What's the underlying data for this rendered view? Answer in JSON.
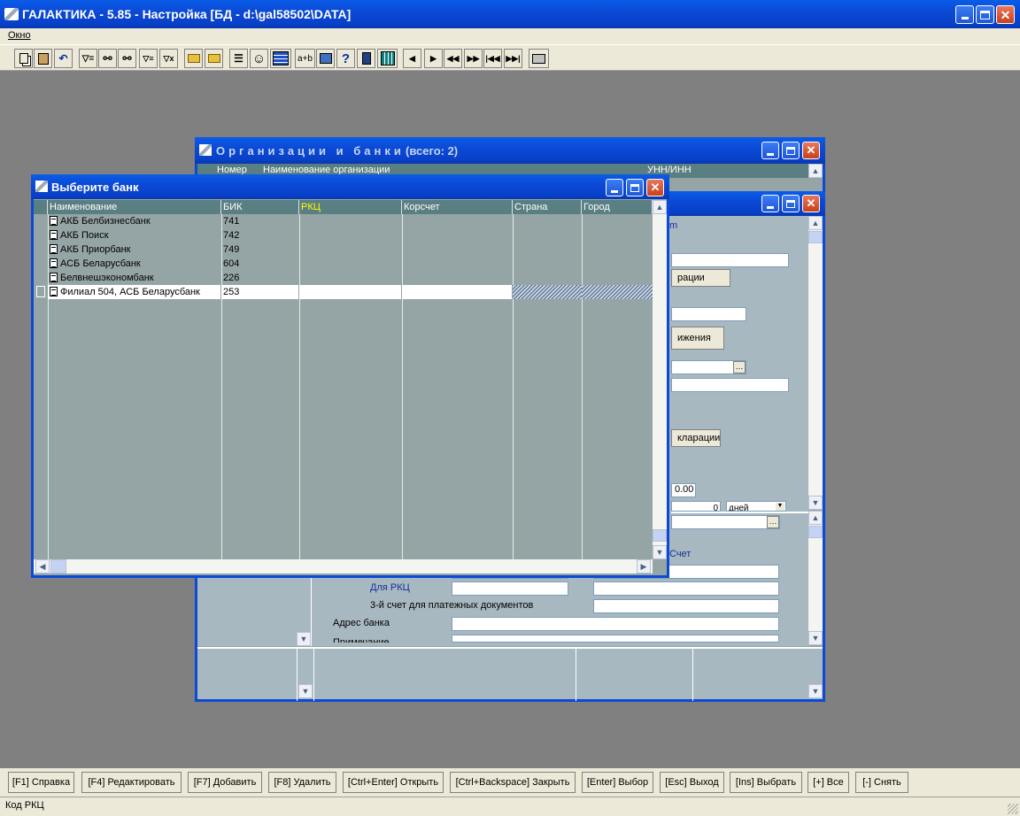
{
  "app": {
    "title": "ГАЛАКТИКА - 5.85 - Настройка [БД - d:\\gal58502\\DATA]",
    "menu": [
      "Окно"
    ]
  },
  "toolbar": {
    "buttons": [
      "copy",
      "paste",
      "undo",
      "filter",
      "find",
      "find-next",
      "filter-set",
      "filter-clear",
      "open",
      "search-folder",
      "list",
      "smile",
      "grid",
      "a+b",
      "calculator",
      "help",
      "exit",
      "table",
      "prev",
      "next",
      "first",
      "last",
      "first-page",
      "last-page",
      "print"
    ],
    "ab_label": "a+b",
    "help_label": "?"
  },
  "org_window": {
    "title": "Организации и банки",
    "count_label": "(всего: 2)",
    "col_number": "Номер",
    "col_name": "Наименование организации",
    "col_unn": "УНН/ИНН",
    "fragments": {
      "m": "m",
      "declaration": "рации",
      "movement": "ижения",
      "declaration2": "кларации",
      "value": "0.00",
      "zero": "0",
      "days": "дней",
      "account": "Счет",
      "for_rkc": "Для РКЦ",
      "third_account": "3-й счет для платежных документов",
      "bank_address": "Адрес банка",
      "note": "Примечание"
    }
  },
  "bank_dialog": {
    "title": "Выберите банк",
    "columns": [
      "Наименование",
      "БИК",
      "РКЦ",
      "Корсчет",
      "Страна",
      "Город"
    ],
    "rows": [
      {
        "name": "АКБ Белбизнесбанк",
        "bik": "741",
        "rkc": "",
        "kors": "",
        "country": "",
        "city": ""
      },
      {
        "name": "АКБ Поиск",
        "bik": "742",
        "rkc": "",
        "kors": "",
        "country": "",
        "city": ""
      },
      {
        "name": "АКБ Приорбанк",
        "bik": "749",
        "rkc": "",
        "kors": "",
        "country": "",
        "city": ""
      },
      {
        "name": "АСБ Беларусбанк",
        "bik": "604",
        "rkc": "",
        "kors": "",
        "country": "",
        "city": ""
      },
      {
        "name": "Белвнешэкономбанк",
        "bik": "226",
        "rkc": "",
        "kors": "",
        "country": "",
        "city": ""
      },
      {
        "name": "Филиал 504, АСБ Беларусбанк",
        "bik": "253",
        "rkc": "",
        "kors": "",
        "country": "",
        "city": ""
      }
    ],
    "selected_row": 5
  },
  "fkeys": [
    "[F1] Справка",
    "[F4] Редактировать",
    "[F7] Добавить",
    "[F8] Удалить",
    "[Ctrl+Enter] Открыть",
    "[Ctrl+Backspace] Закрыть",
    "[Enter] Выбор",
    "[Esc] Выход",
    "[Ins] Выбрать",
    "[+] Все",
    "[-] Снять"
  ],
  "status": {
    "text": "Код РКЦ"
  },
  "colors": {
    "title_bar": "#0b4ad6",
    "grid_bg": "#95a5a5",
    "header_bg": "#5a7f82",
    "rkc_header_text": "#ffff00",
    "desktop": "#808080"
  }
}
